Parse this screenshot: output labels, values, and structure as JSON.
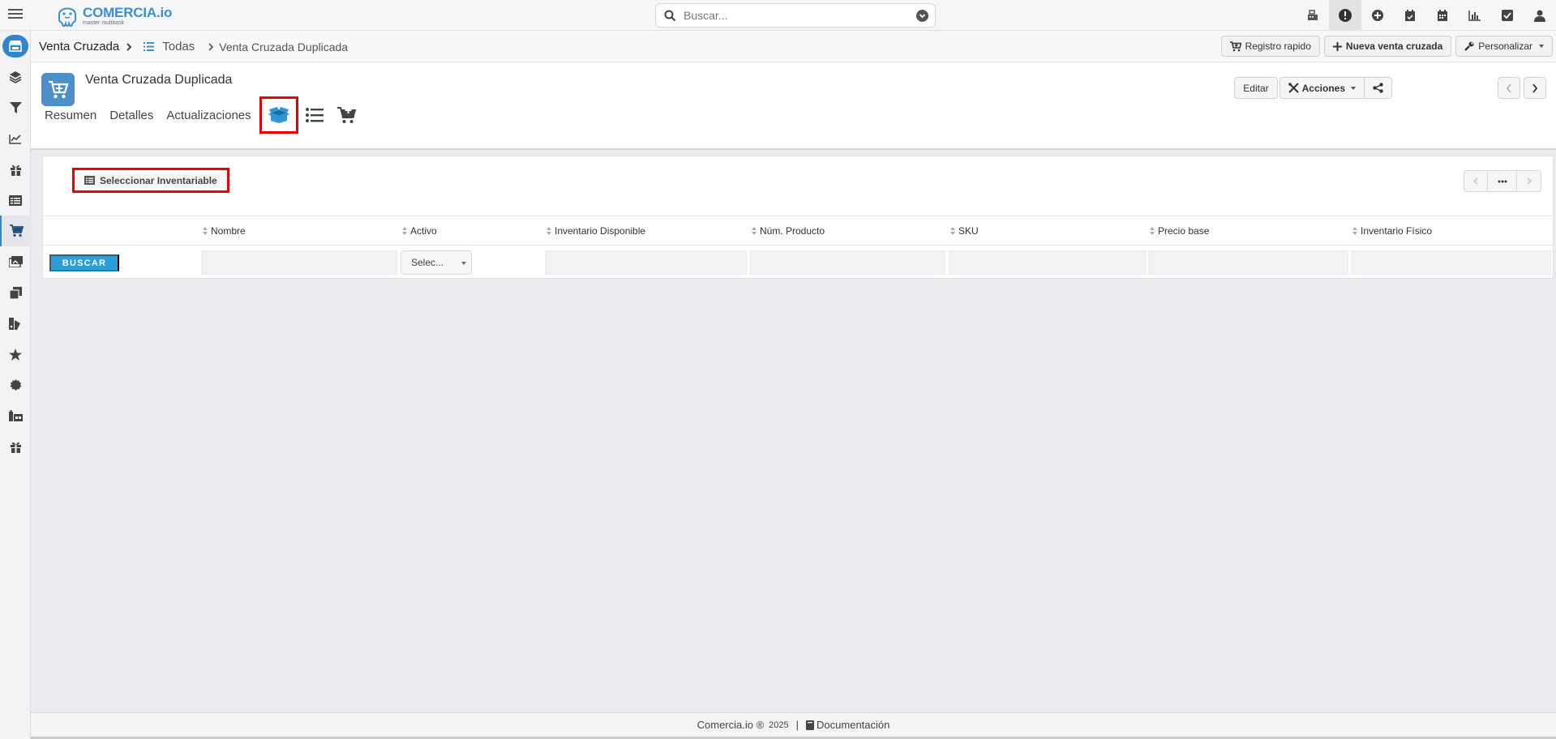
{
  "app": {
    "logo_name": "COMERCIA.io",
    "logo_tagline": "master multitask"
  },
  "search": {
    "placeholder": "Buscar..."
  },
  "top_icons": [
    "cash-register-icon",
    "alert-icon",
    "plus-circle-icon",
    "calendar-check-icon",
    "calendar-icon",
    "bar-chart-icon",
    "checkbox-icon",
    "user-icon"
  ],
  "sidebar": {
    "items": [
      "store-icon",
      "layers-icon",
      "filter-icon",
      "line-chart-icon",
      "gift-icon",
      "list-alt-icon",
      "cart-plus-icon",
      "images-icon",
      "copy-icon",
      "palette-icon",
      "star-icon",
      "certificate-icon",
      "warehouse-icon",
      "gift-icon"
    ],
    "selected_index": 6
  },
  "breadcrumb": {
    "module": "Venta Cruzada",
    "list": "Todas",
    "current": "Venta Cruzada Duplicada"
  },
  "header_buttons": {
    "quick_register": "Registro rapido",
    "new_cross_sale": "Nueva venta cruzada",
    "customize": "Personalizar"
  },
  "record": {
    "title": "Venta Cruzada Duplicada",
    "edit": "Editar",
    "actions": "Acciones",
    "tabs": [
      "Resumen",
      "Detalles",
      "Actualizaciones"
    ]
  },
  "panel": {
    "select_inventory": "Seleccionar Inventariable",
    "search_button": "BUSCAR",
    "columns": [
      "Nombre",
      "Activo",
      "Inventario Disponible",
      "Núm. Producto",
      "SKU",
      "Precio base",
      "Inventario Físico"
    ],
    "active_filter": "Selec..."
  },
  "footer": {
    "brand": "Comercia.io ®",
    "year": "2025",
    "separator": "|",
    "docs": "Documentación"
  },
  "colors": {
    "accent": "#2f86cc",
    "highlight": "#ee0000",
    "search_button": "#2a9fd6"
  }
}
